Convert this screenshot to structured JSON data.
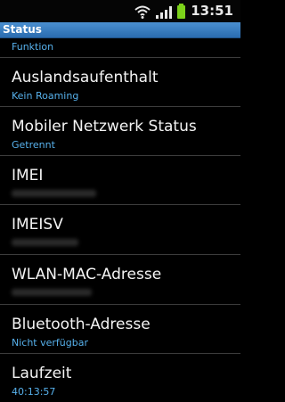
{
  "status_bar": {
    "time": "13:51"
  },
  "header": {
    "title": "Status"
  },
  "items": [
    {
      "label": "",
      "value": "Funktion"
    },
    {
      "label": "Auslandsaufenthalt",
      "value": "Kein Roaming"
    },
    {
      "label": "Mobiler Netzwerk Status",
      "value": "Getrennt"
    },
    {
      "label": "IMEI",
      "value": ""
    },
    {
      "label": "IMEISV",
      "value": ""
    },
    {
      "label": "WLAN-MAC-Adresse",
      "value": ""
    },
    {
      "label": "Bluetooth-Adresse",
      "value": "Nicht verfügbar"
    },
    {
      "label": "Laufzeit",
      "value": "40:13:57"
    }
  ]
}
